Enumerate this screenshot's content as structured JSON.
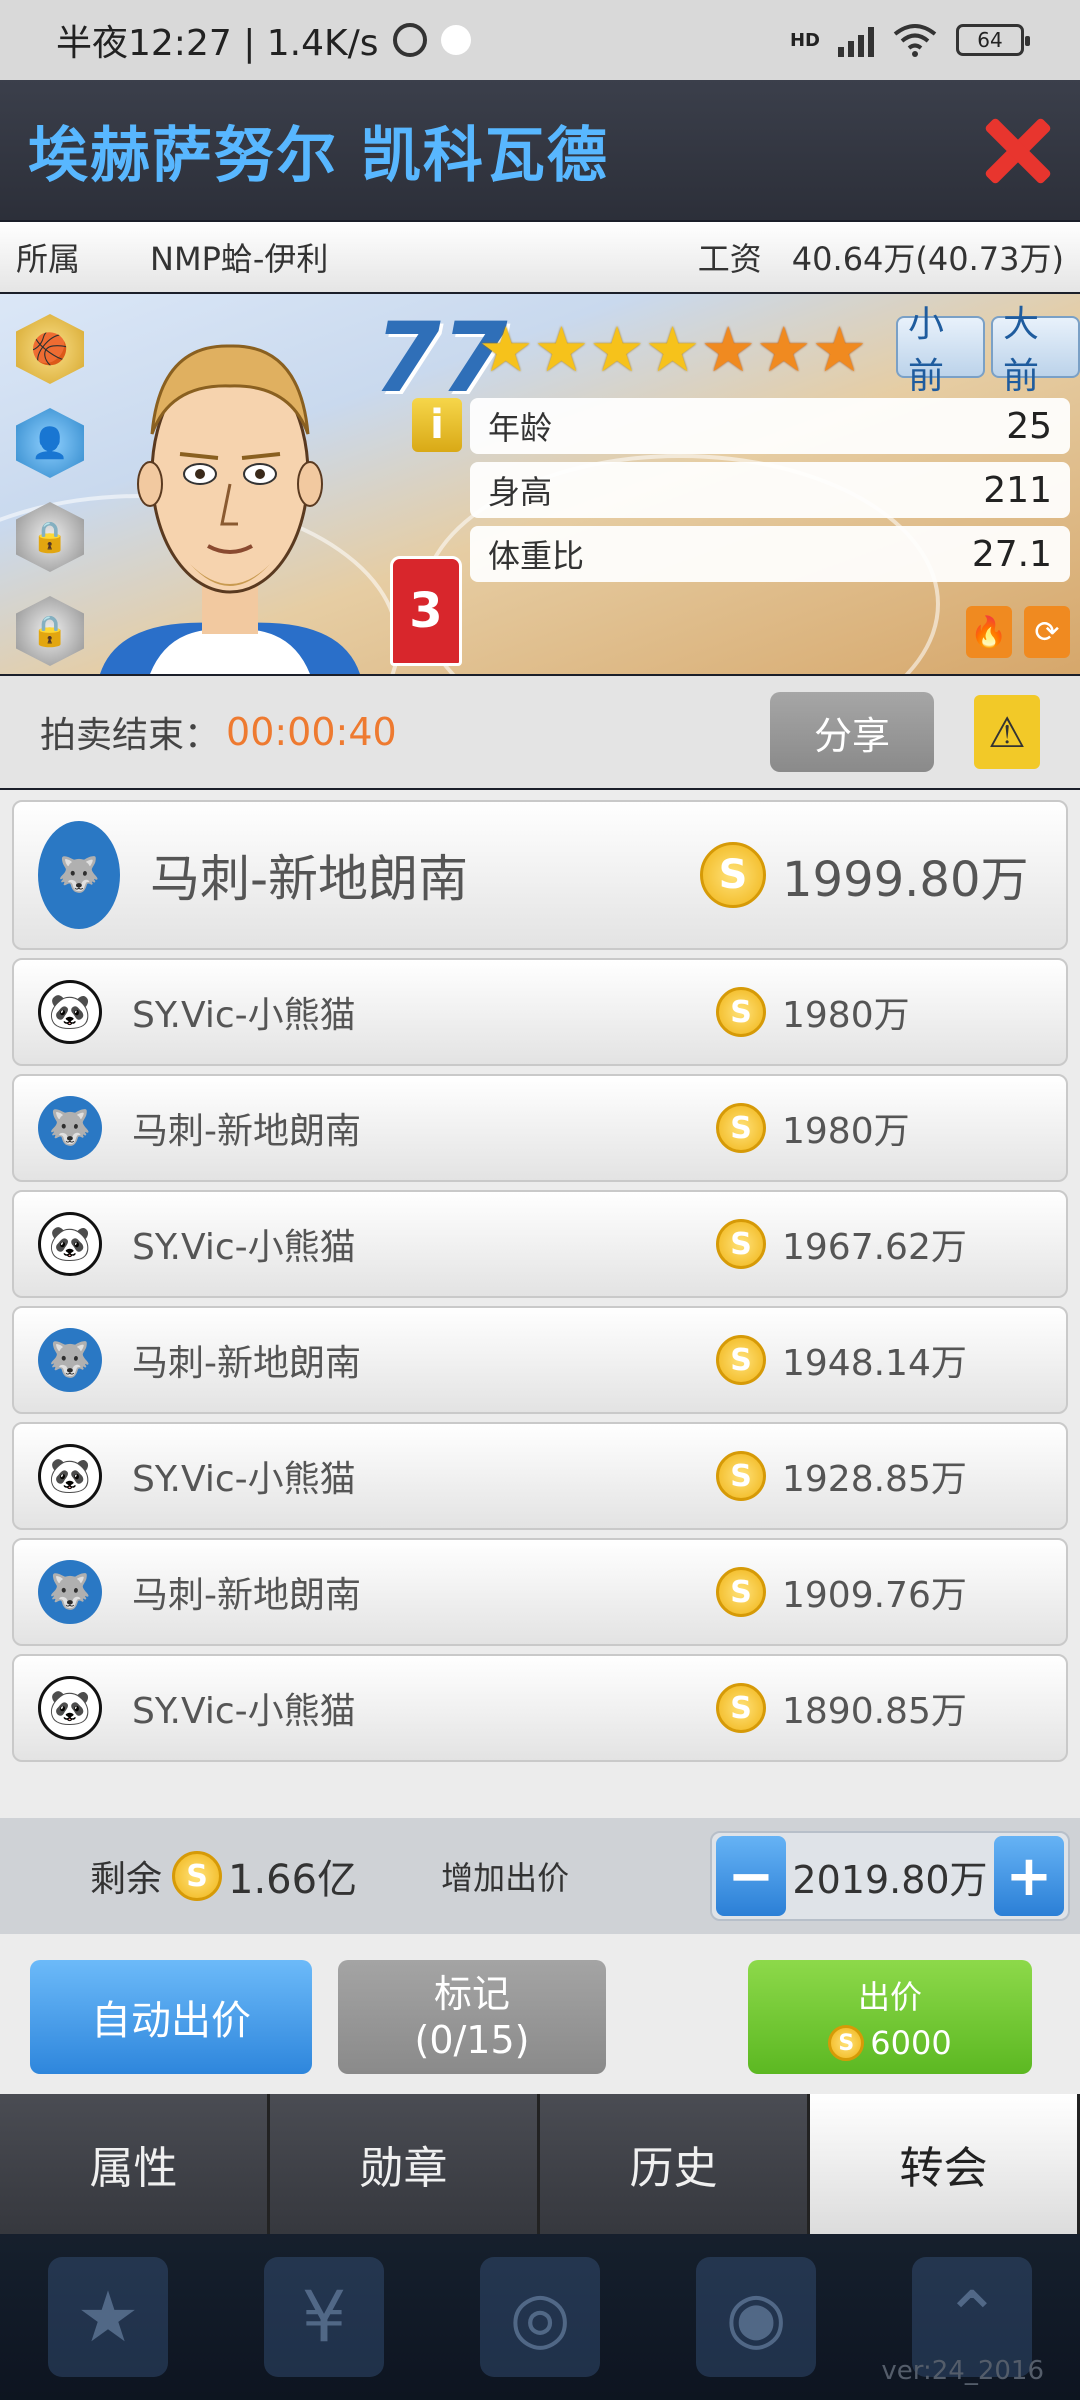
{
  "status_bar": {
    "time_speed": "半夜12:27 | 1.4K/s",
    "hd": "HD",
    "battery": "64"
  },
  "header": {
    "title": "埃赫萨努尔 凯科瓦德"
  },
  "info_row": {
    "team_label": "所属",
    "team_value": "NMP蛤-伊利",
    "salary_label": "工资",
    "salary_value": "40.64万(40.73万)"
  },
  "player": {
    "rating": "77",
    "stars_gold": 4,
    "stars_orange": 3,
    "pos_small": "小前",
    "pos_big": "大前",
    "jersey_number": "3",
    "attributes": [
      {
        "label": "年龄",
        "value": "25"
      },
      {
        "label": "身高",
        "value": "211"
      },
      {
        "label": "体重比",
        "value": "27.1"
      }
    ]
  },
  "auction": {
    "label": "拍卖结束：",
    "timer": "00:00:40",
    "share_label": "分享"
  },
  "bids": [
    {
      "team": "马刺-新地朗南",
      "amount": "1999.80万",
      "logo": "spurs"
    },
    {
      "team": "SY.Vic-小熊猫",
      "amount": "1980万",
      "logo": "panda"
    },
    {
      "team": "马刺-新地朗南",
      "amount": "1980万",
      "logo": "spurs"
    },
    {
      "team": "SY.Vic-小熊猫",
      "amount": "1967.62万",
      "logo": "panda"
    },
    {
      "team": "马刺-新地朗南",
      "amount": "1948.14万",
      "logo": "spurs"
    },
    {
      "team": "SY.Vic-小熊猫",
      "amount": "1928.85万",
      "logo": "panda"
    },
    {
      "team": "马刺-新地朗南",
      "amount": "1909.76万",
      "logo": "spurs"
    },
    {
      "team": "SY.Vic-小熊猫",
      "amount": "1890.85万",
      "logo": "panda"
    }
  ],
  "bid_bar": {
    "remaining_label": "剩余",
    "remaining_value": "1.66亿",
    "increase_label": "增加出价",
    "bid_value": "2019.80万"
  },
  "actions": {
    "auto_bid_label": "自动出价",
    "mark_label": "标记",
    "mark_count": "(0/15)",
    "bid_label": "出价",
    "bid_cost": "6000"
  },
  "tabs": [
    {
      "label": "属性",
      "active": false
    },
    {
      "label": "勋章",
      "active": false
    },
    {
      "label": "历史",
      "active": false
    },
    {
      "label": "转会",
      "active": true
    }
  ],
  "version": "ver:24_2016",
  "colors": {
    "title": "#58b7ff",
    "timer": "#ee7a30",
    "close": "#e8352e",
    "bid_button": "#5cb822"
  }
}
